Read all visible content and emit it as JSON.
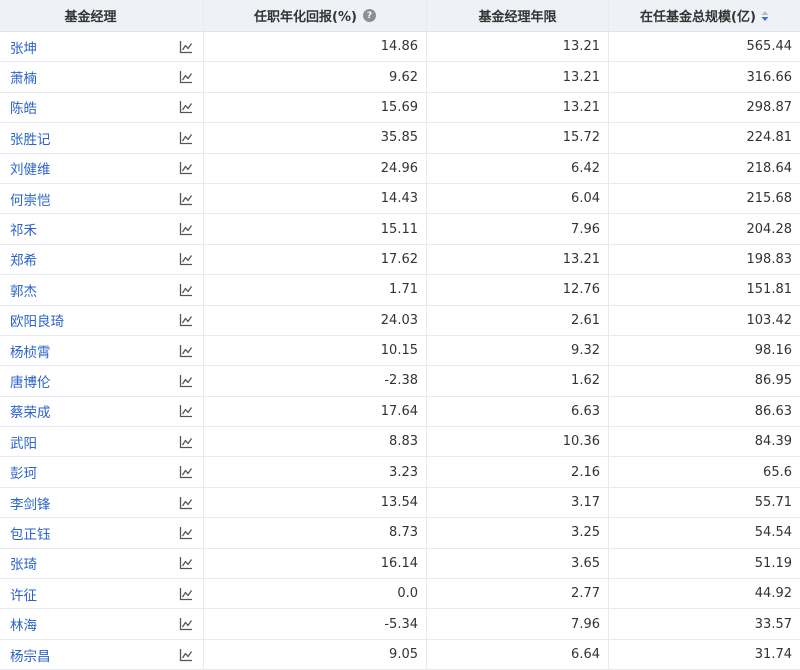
{
  "header": {
    "col_manager": "基金经理",
    "col_return": "任职年化回报(%)",
    "col_years": "基金经理年限",
    "col_scale": "在任基金总规模(亿)"
  },
  "icons": {
    "help": "question-circle-icon",
    "sort": "sort-desc-icon",
    "trend": "line-chart-icon"
  },
  "colors": {
    "link": "#2b63c9",
    "header_bg": "#eef1f6",
    "sort_active": "#3d74d6"
  },
  "rows": [
    {
      "name": "张坤",
      "return": "14.86",
      "years": "13.21",
      "scale": "565.44"
    },
    {
      "name": "萧楠",
      "return": "9.62",
      "years": "13.21",
      "scale": "316.66"
    },
    {
      "name": "陈皓",
      "return": "15.69",
      "years": "13.21",
      "scale": "298.87"
    },
    {
      "name": "张胜记",
      "return": "35.85",
      "years": "15.72",
      "scale": "224.81"
    },
    {
      "name": "刘健维",
      "return": "24.96",
      "years": "6.42",
      "scale": "218.64"
    },
    {
      "name": "何崇恺",
      "return": "14.43",
      "years": "6.04",
      "scale": "215.68"
    },
    {
      "name": "祁禾",
      "return": "15.11",
      "years": "7.96",
      "scale": "204.28"
    },
    {
      "name": "郑希",
      "return": "17.62",
      "years": "13.21",
      "scale": "198.83"
    },
    {
      "name": "郭杰",
      "return": "1.71",
      "years": "12.76",
      "scale": "151.81"
    },
    {
      "name": "欧阳良琦",
      "return": "24.03",
      "years": "2.61",
      "scale": "103.42"
    },
    {
      "name": "杨桢霄",
      "return": "10.15",
      "years": "9.32",
      "scale": "98.16"
    },
    {
      "name": "唐博伦",
      "return": "-2.38",
      "years": "1.62",
      "scale": "86.95"
    },
    {
      "name": "蔡荣成",
      "return": "17.64",
      "years": "6.63",
      "scale": "86.63"
    },
    {
      "name": "武阳",
      "return": "8.83",
      "years": "10.36",
      "scale": "84.39"
    },
    {
      "name": "彭珂",
      "return": "3.23",
      "years": "2.16",
      "scale": "65.6"
    },
    {
      "name": "李剑锋",
      "return": "13.54",
      "years": "3.17",
      "scale": "55.71"
    },
    {
      "name": "包正钰",
      "return": "8.73",
      "years": "3.25",
      "scale": "54.54"
    },
    {
      "name": "张琦",
      "return": "16.14",
      "years": "3.65",
      "scale": "51.19"
    },
    {
      "name": "许征",
      "return": "0.0",
      "years": "2.77",
      "scale": "44.92"
    },
    {
      "name": "林海",
      "return": "-5.34",
      "years": "7.96",
      "scale": "33.57"
    },
    {
      "name": "杨宗昌",
      "return": "9.05",
      "years": "6.64",
      "scale": "31.74"
    }
  ]
}
